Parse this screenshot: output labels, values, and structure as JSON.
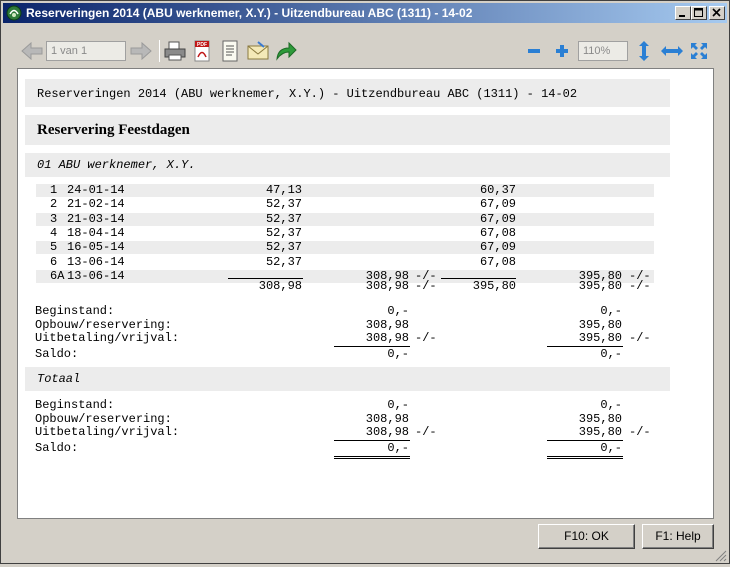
{
  "window": {
    "title": "Reserveringen 2014 (ABU werknemer, X.Y.) - Uitzendbureau ABC (1311) - 14-02"
  },
  "toolbar": {
    "page_value": "1 van 1",
    "zoom_value": "110%",
    "icons": [
      "arrow-left-icon",
      "arrow-right-icon",
      "printer-icon",
      "pdf-icon",
      "document-icon",
      "email-icon",
      "forward-icon",
      "zoom-out-icon",
      "zoom-in-icon",
      "fit-height-icon",
      "fit-width-icon",
      "fit-page-icon"
    ]
  },
  "report": {
    "header": "Reserveringen 2014 (ABU werknemer, X.Y.) - Uitzendbureau ABC (1311) - 14-02",
    "section_title": "Reservering Feestdagen",
    "employee": "01 ABU werknemer, X.Y.",
    "rows": [
      {
        "nr": "1",
        "date": "24-01-14",
        "a": "47,13",
        "b": "",
        "bs": "",
        "c": "60,37",
        "d": "",
        "ds": ""
      },
      {
        "nr": "2",
        "date": "21-02-14",
        "a": "52,37",
        "b": "",
        "bs": "",
        "c": "67,09",
        "d": "",
        "ds": ""
      },
      {
        "nr": "3",
        "date": "21-03-14",
        "a": "52,37",
        "b": "",
        "bs": "",
        "c": "67,09",
        "d": "",
        "ds": ""
      },
      {
        "nr": "4",
        "date": "18-04-14",
        "a": "52,37",
        "b": "",
        "bs": "",
        "c": "67,08",
        "d": "",
        "ds": ""
      },
      {
        "nr": "5",
        "date": "16-05-14",
        "a": "52,37",
        "b": "",
        "bs": "",
        "c": "67,09",
        "d": "",
        "ds": ""
      },
      {
        "nr": "6",
        "date": "13-06-14",
        "a": "52,37",
        "b": "",
        "bs": "",
        "c": "67,08",
        "d": "",
        "ds": ""
      },
      {
        "nr": "6A",
        "date": "13-06-14",
        "a": "",
        "b": "308,98",
        "bs": "-/-",
        "c": "",
        "d": "395,80",
        "ds": "-/-"
      }
    ],
    "totals": {
      "a": "308,98",
      "b": "308,98",
      "bs": "-/-",
      "c": "395,80",
      "d": "395,80",
      "ds": "-/-"
    },
    "summary1": [
      {
        "label": "Beginstand:",
        "b": "0,-",
        "bs": "",
        "d": "0,-",
        "ds": ""
      },
      {
        "label": "Opbouw/reservering:",
        "b": "308,98",
        "bs": "",
        "d": "395,80",
        "ds": ""
      },
      {
        "label": "Uitbetaling/vrijval:",
        "b": "308,98",
        "bs": "-/-",
        "d": "395,80",
        "ds": "-/-"
      },
      {
        "label": "Saldo:",
        "b": "0,-",
        "bs": "",
        "d": "0,-",
        "ds": ""
      }
    ],
    "total_title": "Totaal",
    "summary2": [
      {
        "label": "Beginstand:",
        "b": "0,-",
        "bs": "",
        "d": "0,-",
        "ds": ""
      },
      {
        "label": "Opbouw/reservering:",
        "b": "308,98",
        "bs": "",
        "d": "395,80",
        "ds": ""
      },
      {
        "label": "Uitbetaling/vrijval:",
        "b": "308,98",
        "bs": "-/-",
        "d": "395,80",
        "ds": "-/-"
      },
      {
        "label": "Saldo:",
        "b": "0,-",
        "bs": "",
        "d": "0,-",
        "ds": ""
      }
    ]
  },
  "buttons": {
    "ok": "F10: OK",
    "help": "F1: Help"
  }
}
